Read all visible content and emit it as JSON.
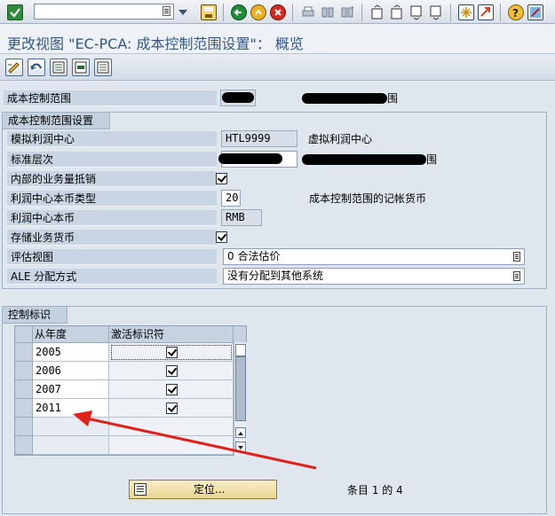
{
  "title": "更改视图 \"EC-PCA: 成本控制范围设置\"： 概览",
  "header": {
    "co_area_label": "成本控制范围",
    "co_area_desc_suffix": "围"
  },
  "settings": {
    "group_title": "成本控制范围设置",
    "dummy_pc_label": "模拟利润中心",
    "dummy_pc_value": "HTL9999",
    "dummy_pc_desc": "虚拟利润中心",
    "std_hier_label": "标准层次",
    "std_hier_desc_suffix": "围",
    "elim_label": "内部的业务量抵销",
    "curr_type_label": "利润中心本币类型",
    "curr_type_value": "20",
    "curr_type_desc": "成本控制范围的记帐货币",
    "pc_currency_label": "利润中心本币",
    "pc_currency_value": "RMB",
    "store_tx_curr_label": "存储业务货币",
    "valuation_label": "评估视图",
    "valuation_value": "0 合法估价",
    "ale_label": "ALE 分配方式",
    "ale_value": "没有分配到其他系统"
  },
  "control": {
    "group_title": "控制标识",
    "col_year": "从年度",
    "col_active": "激活标识符",
    "rows": [
      "2005",
      "2006",
      "2007",
      "2011"
    ]
  },
  "footer": {
    "position_button": "定位...",
    "entry_info": "条目 1 的 4"
  },
  "colors": {
    "title_text": "#33588a",
    "arrow": "#e0201a"
  }
}
